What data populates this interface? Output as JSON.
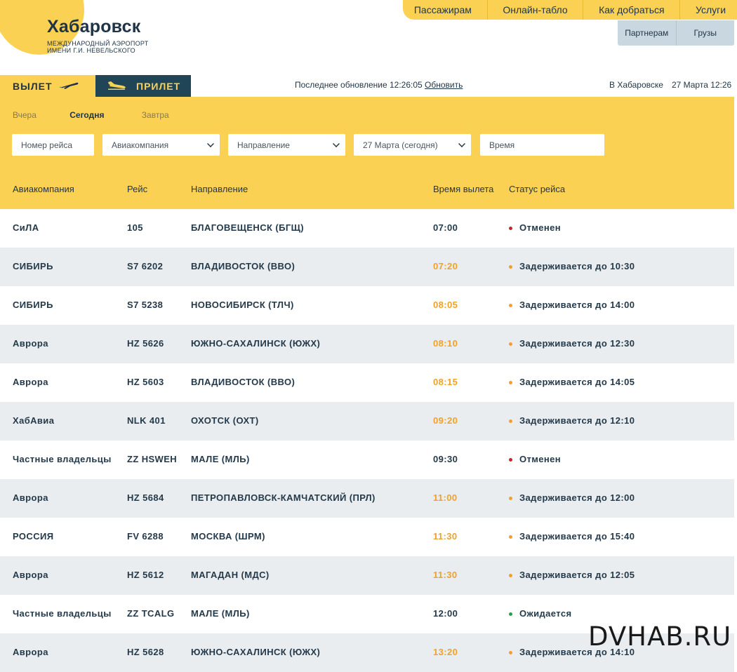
{
  "header": {
    "city": "Хабаровск",
    "subtitle_line1": "МЕЖДУНАРОДНЫЙ АЭРОПОРТ",
    "subtitle_line2": "ИМЕНИ Г.И. НЕВЕЛЬСКОГО",
    "nav": [
      "Пассажирам",
      "Онлайн-табло",
      "Как добраться",
      "Услуги"
    ],
    "subnav": [
      "Партнерам",
      "Грузы"
    ]
  },
  "tabs": {
    "departure": "ВЫЛЕТ",
    "arrival": "ПРИЛЕТ"
  },
  "update": {
    "label": "Последнее обновление 12:26:05",
    "refresh": "Обновить"
  },
  "local": {
    "city": "В Хабаровске",
    "datetime": "27 Марта 12:26"
  },
  "days": [
    "Вчера",
    "Сегодня",
    "Завтра"
  ],
  "filters": {
    "flight": "Номер рейса",
    "airline": "Авиакомпания",
    "direction": "Направление",
    "date": "27 Марта (сегодня)",
    "time": "Время"
  },
  "table": {
    "headers": [
      "Авиакомпания",
      "Рейс",
      "Направление",
      "Время вылета",
      "Статус рейса"
    ],
    "rows": [
      {
        "airline": "СиЛА",
        "flight": "105",
        "dir": "БЛАГОВЕЩЕНСК (БГЩ)",
        "time": "07:00",
        "status": "Отменен",
        "kind": "cancel"
      },
      {
        "airline": "СИБИРЬ",
        "flight": "S7 6202",
        "dir": "ВЛАДИВОСТОК (ВВО)",
        "time": "07:20",
        "status": "Задерживается до 10:30",
        "kind": "delay"
      },
      {
        "airline": "СИБИРЬ",
        "flight": "S7 5238",
        "dir": "НОВОСИБИРСК (ТЛЧ)",
        "time": "08:05",
        "status": "Задерживается до 14:00",
        "kind": "delay"
      },
      {
        "airline": "Аврора",
        "flight": "HZ 5626",
        "dir": "ЮЖНО-САХАЛИНСК (ЮЖХ)",
        "time": "08:10",
        "status": "Задерживается до 12:30",
        "kind": "delay"
      },
      {
        "airline": "Аврора",
        "flight": "HZ 5603",
        "dir": "ВЛАДИВОСТОК (ВВО)",
        "time": "08:15",
        "status": "Задерживается до 14:05",
        "kind": "delay"
      },
      {
        "airline": "ХабАвиа",
        "flight": "NLK 401",
        "dir": "ОХОТСК (ОХТ)",
        "time": "09:20",
        "status": "Задерживается до 12:10",
        "kind": "delay"
      },
      {
        "airline": "Частные владельцы",
        "flight": "ZZ HSWEH",
        "dir": "МАЛЕ (МЛЬ)",
        "time": "09:30",
        "status": "Отменен",
        "kind": "cancel"
      },
      {
        "airline": "Аврора",
        "flight": "HZ 5684",
        "dir": "ПЕТРОПАВЛОВСК-КАМЧАТСКИЙ (ПРЛ)",
        "time": "11:00",
        "status": "Задерживается до 12:00",
        "kind": "delay"
      },
      {
        "airline": "РОССИЯ",
        "flight": "FV 6288",
        "dir": "МОСКВА (ШРМ)",
        "time": "11:30",
        "status": "Задерживается до 15:40",
        "kind": "delay"
      },
      {
        "airline": "Аврора",
        "flight": "HZ 5612",
        "dir": "МАГАДАН (МДС)",
        "time": "11:30",
        "status": "Задерживается до 12:05",
        "kind": "delay"
      },
      {
        "airline": "Частные владельцы",
        "flight": "ZZ TCALG",
        "dir": "МАЛЕ (МЛЬ)",
        "time": "12:00",
        "status": "Ожидается",
        "kind": "expected"
      },
      {
        "airline": "Аврора",
        "flight": "HZ 5628",
        "dir": "ЮЖНО-САХАЛИНСК (ЮЖХ)",
        "time": "13:20",
        "status": "Задерживается до 14:10",
        "kind": "delay"
      }
    ]
  },
  "colors": {
    "accent": "#fbd154",
    "dark": "#1f4556",
    "cancel": "#c0282a",
    "delay": "#f0a12a",
    "expected": "#2e9a4a"
  },
  "watermark": "DVHAB.RU"
}
